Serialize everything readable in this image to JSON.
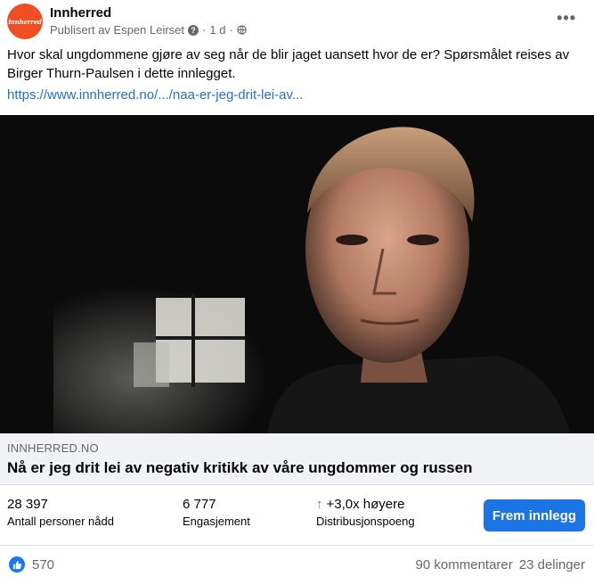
{
  "post": {
    "page_name": "Innherred",
    "avatar_text": "innherred",
    "published_by": "Publisert av Espen Leirset",
    "time": "1 d",
    "text": "Hvor skal ungdommene gjøre av seg når de blir jaget uansett hvor de er? Spørsmålet reises av Birger Thurn-Paulsen i dette innlegget.",
    "link": "https://www.innherred.no/.../naa-er-jeg-drit-lei-av..."
  },
  "link_card": {
    "domain": "INNHERRED.NO",
    "headline": "Nå er jeg drit lei av negativ kritikk av våre ungdommer og russen"
  },
  "insights": {
    "reach_value": "28 397",
    "reach_label": "Antall personer nådd",
    "engagement_value": "6 777",
    "engagement_label": "Engasjement",
    "distribution_value": "+3,0x høyere",
    "distribution_label": "Distribusjonspoeng",
    "boost_label": "Frem innlegg"
  },
  "footer": {
    "reactions_count": "570",
    "comments": "90 kommentarer",
    "shares": "23 delinger"
  },
  "colors": {
    "brand": "#f04e23",
    "link": "#216fdb",
    "button": "#1b74e4",
    "up_arrow": "#31a24c"
  },
  "icons": [
    "more-icon",
    "question-icon",
    "globe-icon",
    "up-arrow-icon",
    "like-icon"
  ]
}
